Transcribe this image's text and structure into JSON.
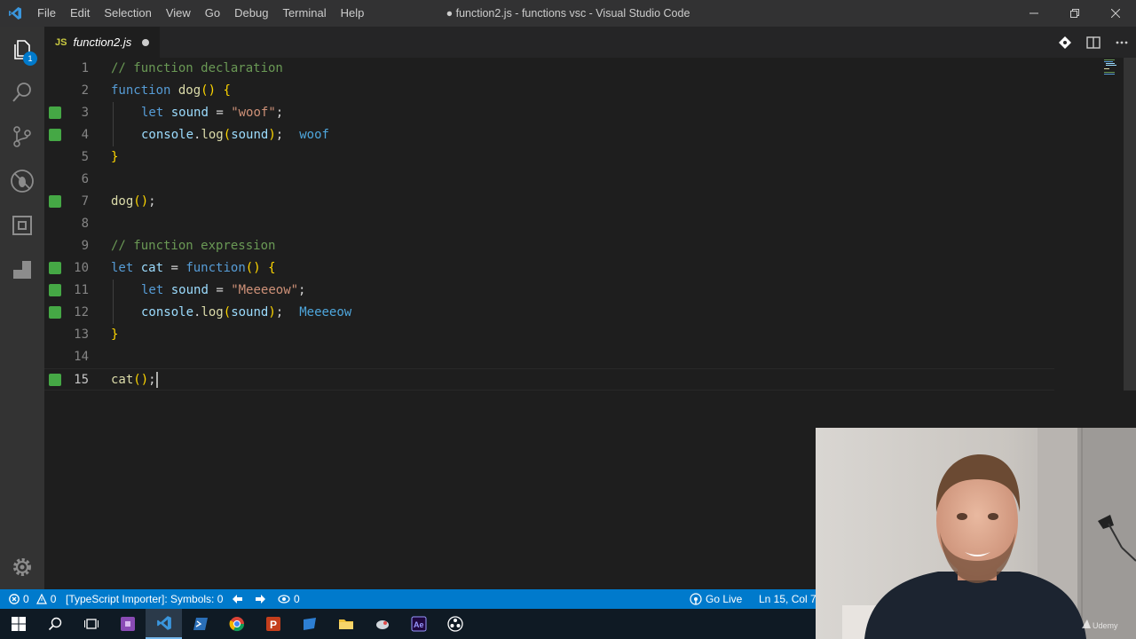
{
  "window": {
    "title": "● function2.js - functions vsc - Visual Studio Code",
    "menu": [
      "File",
      "Edit",
      "Selection",
      "View",
      "Go",
      "Debug",
      "Terminal",
      "Help"
    ]
  },
  "activity": {
    "explorer_badge": "1"
  },
  "tab": {
    "icon_text": "JS",
    "name": "function2.js"
  },
  "editor": {
    "lines": [
      {
        "num": "1",
        "modified": false
      },
      {
        "num": "2",
        "modified": false
      },
      {
        "num": "3",
        "modified": true
      },
      {
        "num": "4",
        "modified": true
      },
      {
        "num": "5",
        "modified": false
      },
      {
        "num": "6",
        "modified": false
      },
      {
        "num": "7",
        "modified": true
      },
      {
        "num": "8",
        "modified": false
      },
      {
        "num": "9",
        "modified": false
      },
      {
        "num": "10",
        "modified": true
      },
      {
        "num": "11",
        "modified": true
      },
      {
        "num": "12",
        "modified": true
      },
      {
        "num": "13",
        "modified": false
      },
      {
        "num": "14",
        "modified": false
      },
      {
        "num": "15",
        "modified": true
      }
    ],
    "code": {
      "l1": "// function declaration",
      "l2_kw": "function",
      "l2_name": "dog",
      "l3_kw": "let",
      "l3_var": "sound",
      "l3_str": "\"woof\"",
      "l4_obj": "console",
      "l4_fn": "log",
      "l4_arg": "sound",
      "l4_result": "woof",
      "l7_fn": "dog",
      "l9": "// function expression",
      "l10_kw": "let",
      "l10_var": "cat",
      "l10_fn": "function",
      "l11_kw": "let",
      "l11_var": "sound",
      "l11_str": "\"Meeeeow\"",
      "l12_obj": "console",
      "l12_fn": "log",
      "l12_arg": "sound",
      "l12_result": "Meeeeow",
      "l15_fn": "cat"
    }
  },
  "statusbar": {
    "errors": "0",
    "warnings": "0",
    "importer": "[TypeScript Importer]: Symbols: 0",
    "watch": "0",
    "go_live": "Go Live",
    "position": "Ln 15, Col 7"
  },
  "webcam": {
    "watermark": "Udemy"
  }
}
